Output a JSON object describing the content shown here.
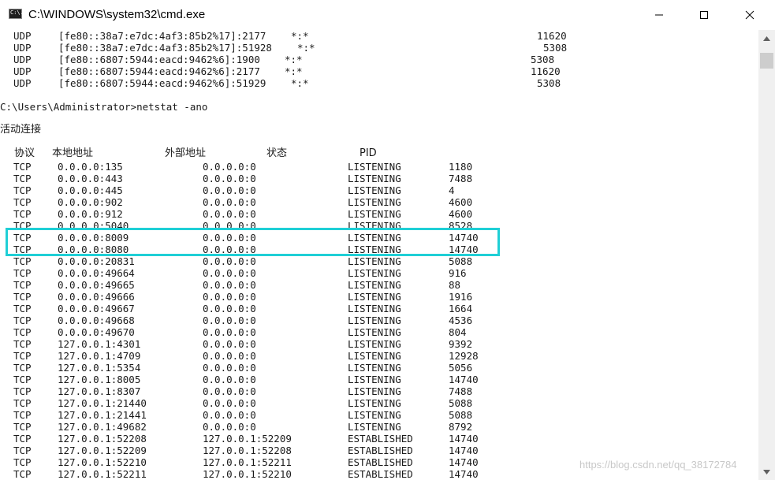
{
  "window": {
    "title": "C:\\WINDOWS\\system32\\cmd.exe",
    "icon_text": "C:\\."
  },
  "udp_rows": [
    {
      "proto": "UDP",
      "local": "[fe80::38a7:e7dc:4af3:85b2%17]:2177",
      "foreign": "*:*",
      "pid": "11620"
    },
    {
      "proto": "UDP",
      "local": "[fe80::38a7:e7dc:4af3:85b2%17]:51928",
      "foreign": "*:*",
      "pid": "5308"
    },
    {
      "proto": "UDP",
      "local": "[fe80::6807:5944:eacd:9462%6]:1900",
      "foreign": "*:*",
      "pid": "5308"
    },
    {
      "proto": "UDP",
      "local": "[fe80::6807:5944:eacd:9462%6]:2177",
      "foreign": "*:*",
      "pid": "11620"
    },
    {
      "proto": "UDP",
      "local": "[fe80::6807:5944:eacd:9462%6]:51929",
      "foreign": "*:*",
      "pid": "5308"
    }
  ],
  "command": "C:\\Users\\Administrator>netstat -ano",
  "section_title": "活动连接",
  "headers": {
    "proto": "协议",
    "local": "本地地址",
    "foreign": "外部地址",
    "state": "状态",
    "pid": "PID"
  },
  "rows": [
    {
      "proto": "TCP",
      "local": "0.0.0.0:135",
      "foreign": "0.0.0.0:0",
      "state": "LISTENING",
      "pid": "1180"
    },
    {
      "proto": "TCP",
      "local": "0.0.0.0:443",
      "foreign": "0.0.0.0:0",
      "state": "LISTENING",
      "pid": "7488"
    },
    {
      "proto": "TCP",
      "local": "0.0.0.0:445",
      "foreign": "0.0.0.0:0",
      "state": "LISTENING",
      "pid": "4"
    },
    {
      "proto": "TCP",
      "local": "0.0.0.0:902",
      "foreign": "0.0.0.0:0",
      "state": "LISTENING",
      "pid": "4600"
    },
    {
      "proto": "TCP",
      "local": "0.0.0.0:912",
      "foreign": "0.0.0.0:0",
      "state": "LISTENING",
      "pid": "4600"
    },
    {
      "proto": "TCP",
      "local": "0.0.0.0:5040",
      "foreign": "0.0.0.0:0",
      "state": "LISTENING",
      "pid": "8528"
    },
    {
      "proto": "TCP",
      "local": "0.0.0.0:8009",
      "foreign": "0.0.0.0:0",
      "state": "LISTENING",
      "pid": "14740"
    },
    {
      "proto": "TCP",
      "local": "0.0.0.0:8080",
      "foreign": "0.0.0.0:0",
      "state": "LISTENING",
      "pid": "14740"
    },
    {
      "proto": "TCP",
      "local": "0.0.0.0:20831",
      "foreign": "0.0.0.0:0",
      "state": "LISTENING",
      "pid": "5088"
    },
    {
      "proto": "TCP",
      "local": "0.0.0.0:49664",
      "foreign": "0.0.0.0:0",
      "state": "LISTENING",
      "pid": "916"
    },
    {
      "proto": "TCP",
      "local": "0.0.0.0:49665",
      "foreign": "0.0.0.0:0",
      "state": "LISTENING",
      "pid": "88"
    },
    {
      "proto": "TCP",
      "local": "0.0.0.0:49666",
      "foreign": "0.0.0.0:0",
      "state": "LISTENING",
      "pid": "1916"
    },
    {
      "proto": "TCP",
      "local": "0.0.0.0:49667",
      "foreign": "0.0.0.0:0",
      "state": "LISTENING",
      "pid": "1664"
    },
    {
      "proto": "TCP",
      "local": "0.0.0.0:49668",
      "foreign": "0.0.0.0:0",
      "state": "LISTENING",
      "pid": "4536"
    },
    {
      "proto": "TCP",
      "local": "0.0.0.0:49670",
      "foreign": "0.0.0.0:0",
      "state": "LISTENING",
      "pid": "804"
    },
    {
      "proto": "TCP",
      "local": "127.0.0.1:4301",
      "foreign": "0.0.0.0:0",
      "state": "LISTENING",
      "pid": "9392"
    },
    {
      "proto": "TCP",
      "local": "127.0.0.1:4709",
      "foreign": "0.0.0.0:0",
      "state": "LISTENING",
      "pid": "12928"
    },
    {
      "proto": "TCP",
      "local": "127.0.0.1:5354",
      "foreign": "0.0.0.0:0",
      "state": "LISTENING",
      "pid": "5056"
    },
    {
      "proto": "TCP",
      "local": "127.0.0.1:8005",
      "foreign": "0.0.0.0:0",
      "state": "LISTENING",
      "pid": "14740"
    },
    {
      "proto": "TCP",
      "local": "127.0.0.1:8307",
      "foreign": "0.0.0.0:0",
      "state": "LISTENING",
      "pid": "7488"
    },
    {
      "proto": "TCP",
      "local": "127.0.0.1:21440",
      "foreign": "0.0.0.0:0",
      "state": "LISTENING",
      "pid": "5088"
    },
    {
      "proto": "TCP",
      "local": "127.0.0.1:21441",
      "foreign": "0.0.0.0:0",
      "state": "LISTENING",
      "pid": "5088"
    },
    {
      "proto": "TCP",
      "local": "127.0.0.1:49682",
      "foreign": "0.0.0.0:0",
      "state": "LISTENING",
      "pid": "8792"
    },
    {
      "proto": "TCP",
      "local": "127.0.0.1:52208",
      "foreign": "127.0.0.1:52209",
      "state": "ESTABLISHED",
      "pid": "14740"
    },
    {
      "proto": "TCP",
      "local": "127.0.0.1:52209",
      "foreign": "127.0.0.1:52208",
      "state": "ESTABLISHED",
      "pid": "14740"
    },
    {
      "proto": "TCP",
      "local": "127.0.0.1:52210",
      "foreign": "127.0.0.1:52211",
      "state": "ESTABLISHED",
      "pid": "14740"
    },
    {
      "proto": "TCP",
      "local": "127.0.0.1:52211",
      "foreign": "127.0.0.1:52210",
      "state": "ESTABLISHED",
      "pid": "14740"
    }
  ],
  "watermark": "https://blog.csdn.net/qq_38172784",
  "colors": {
    "highlight": "#1fcfd6",
    "text": "#1a1a1a",
    "background": "#ffffff"
  }
}
